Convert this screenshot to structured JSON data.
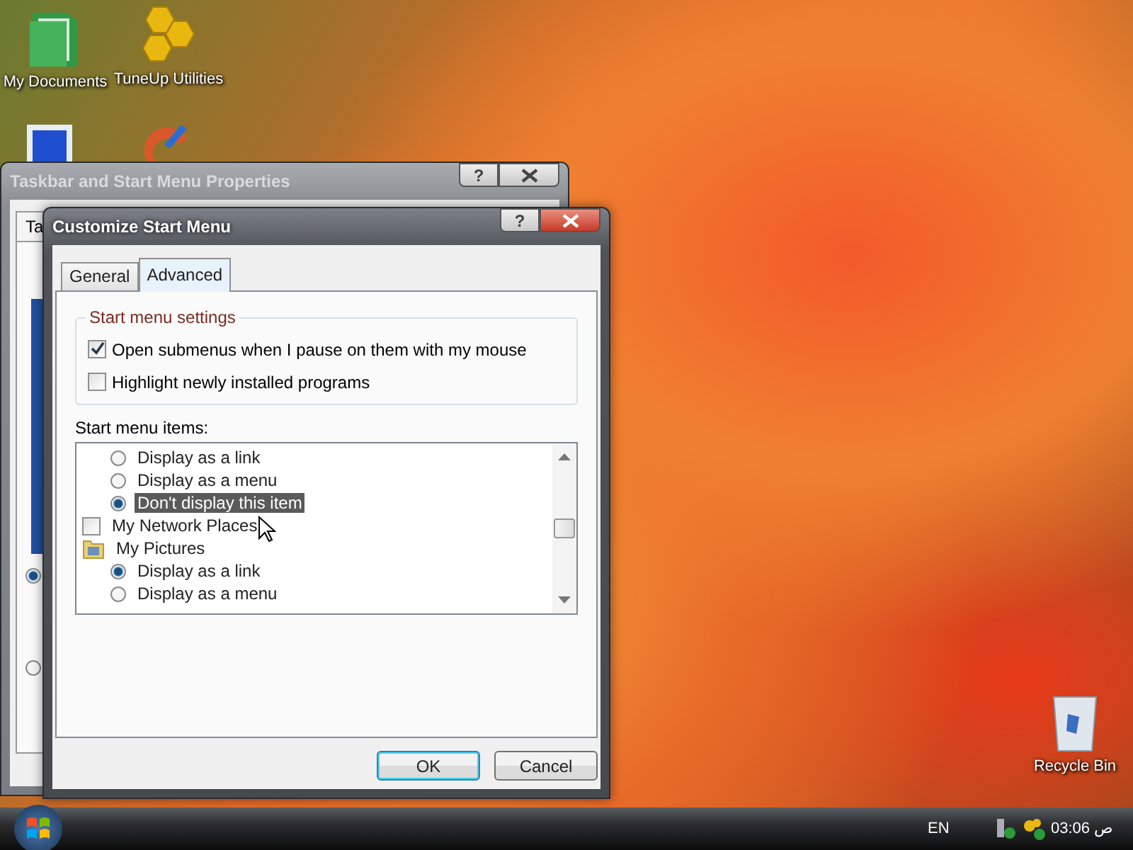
{
  "desktop_icons": [
    {
      "label": "My Documents",
      "kind": "folder"
    },
    {
      "label": "TuneUp Utilities",
      "kind": "tuneup"
    },
    {
      "label": "Recycle Bin",
      "kind": "bin"
    }
  ],
  "back_window": {
    "title": "Taskbar and Start Menu Properties",
    "help": "?",
    "tab": "Ta",
    "radios": [
      {
        "selected": true
      },
      {
        "selected": false
      }
    ]
  },
  "window": {
    "title": "Customize Start Menu",
    "help": "?",
    "tabs": [
      {
        "label": "General",
        "selected": false
      },
      {
        "label": "Advanced",
        "selected": true
      }
    ],
    "group": {
      "title": "Start menu settings",
      "options": [
        {
          "label": "Open submenus when I pause on them with my mouse",
          "checked": true
        },
        {
          "label": "Highlight newly installed programs",
          "checked": false
        }
      ]
    },
    "list_label": "Start menu items:",
    "items": [
      {
        "kind": "radio",
        "label": "Display as a link",
        "selected": false,
        "highlighted": false
      },
      {
        "kind": "radio",
        "label": "Display as a menu",
        "selected": false,
        "highlighted": false
      },
      {
        "kind": "radio",
        "label": "Don't display this item",
        "selected": true,
        "highlighted": true
      },
      {
        "kind": "checkbox",
        "label": "My Network Places",
        "checked": false,
        "highlighted": false
      },
      {
        "kind": "folder",
        "label": "My Pictures",
        "highlighted": false
      },
      {
        "kind": "radio",
        "label": "Display as a link",
        "selected": true,
        "highlighted": false
      },
      {
        "kind": "radio",
        "label": "Display as a menu",
        "selected": false,
        "highlighted": false
      }
    ],
    "buttons": [
      {
        "label": "OK",
        "default": true
      },
      {
        "label": "Cancel",
        "default": false
      }
    ]
  },
  "taskbar": {
    "language": "EN",
    "time": "03:06",
    "period": "ص"
  }
}
